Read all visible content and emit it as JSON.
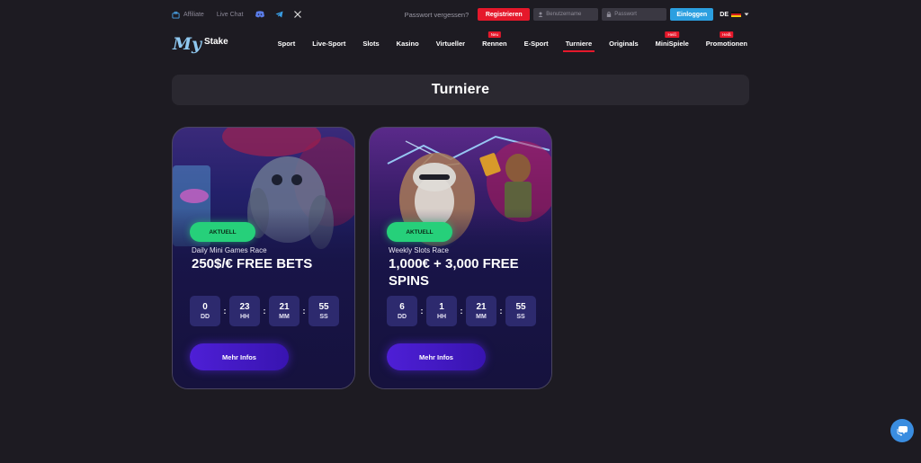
{
  "topbar": {
    "affiliate": "Affiliate",
    "live_chat": "Live Chat",
    "forgot_password": "Passwort vergessen?",
    "register": "Registrieren",
    "username_placeholder": "Benutzername",
    "password_placeholder": "Passwort",
    "login": "Einloggen",
    "language": "DE"
  },
  "logo": {
    "text_my": "My",
    "text_stake": "Stake"
  },
  "nav": {
    "items": [
      {
        "label": "Sport",
        "badge": ""
      },
      {
        "label": "Live-Sport",
        "badge": ""
      },
      {
        "label": "Slots",
        "badge": ""
      },
      {
        "label": "Kasino",
        "badge": ""
      },
      {
        "label": "Virtueller",
        "badge": ""
      },
      {
        "label": "Rennen",
        "badge": "Neu"
      },
      {
        "label": "E-Sport",
        "badge": ""
      },
      {
        "label": "Turniere",
        "badge": ""
      },
      {
        "label": "Originals",
        "badge": ""
      },
      {
        "label": "MiniSpiele",
        "badge": "Heiß"
      },
      {
        "label": "Promotionen",
        "badge": "Heiß"
      }
    ]
  },
  "page": {
    "title": "Turniere"
  },
  "cards": [
    {
      "status": "AKTUELL",
      "subtitle": "Daily Mini Games Race",
      "title": "250$/€ FREE BETS",
      "timer": {
        "dd": "0",
        "hh": "23",
        "mm": "21",
        "ss": "55"
      },
      "button": "Mehr Infos"
    },
    {
      "status": "AKTUELL",
      "subtitle": "Weekly Slots Race",
      "title": "1,000€ + 3,000 FREE SPINS",
      "timer": {
        "dd": "6",
        "hh": "1",
        "mm": "21",
        "ss": "55"
      },
      "button": "Mehr Infos"
    }
  ],
  "timer_units": {
    "dd": "DD",
    "hh": "HH",
    "mm": "MM",
    "ss": "SS"
  },
  "colors": {
    "accent_red": "#e5182b",
    "accent_blue": "#2b9fe0",
    "status_green": "#26d07a",
    "button_purple": "#4e1fd6"
  }
}
